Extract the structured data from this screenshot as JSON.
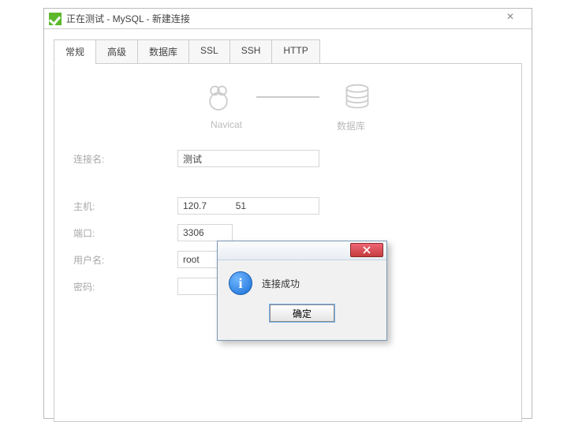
{
  "window": {
    "title": "正在测试 - MySQL - 新建连接",
    "close_glyph": "✕"
  },
  "tabs": {
    "general": "常规",
    "advanced": "高级",
    "database": "数据库",
    "ssl": "SSL",
    "ssh": "SSH",
    "http": "HTTP"
  },
  "header": {
    "navicat_label": "Navicat",
    "db_label": "数据库"
  },
  "form": {
    "conn_name_label": "连接名:",
    "conn_name_value": "测试",
    "host_label": "主机:",
    "host_value": "120.7           51",
    "port_label": "端口:",
    "port_value": "3306",
    "user_label": "用户名:",
    "user_value": "root",
    "pwd_label": "密码:",
    "pwd_value": ""
  },
  "dialog": {
    "message": "连接成功",
    "ok": "确定"
  }
}
